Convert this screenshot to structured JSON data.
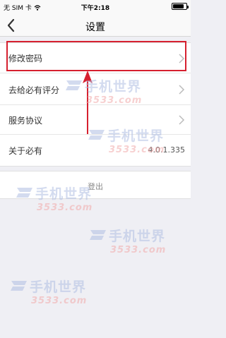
{
  "status_bar": {
    "carrier": "无 SIM 卡",
    "time": "下午2:18",
    "battery_level": 0.85
  },
  "nav": {
    "title": "设置",
    "back_icon": "chevron-left-icon"
  },
  "settings": {
    "items": [
      {
        "label": "修改密码",
        "value": ""
      },
      {
        "label": "去给必有评分",
        "value": ""
      },
      {
        "label": "服务协议",
        "value": ""
      },
      {
        "label": "关于必有",
        "value": "4.0.1.335"
      }
    ]
  },
  "logout": {
    "label": "登出"
  },
  "watermark": {
    "name": "手机世界",
    "site": "3533.com"
  },
  "colors": {
    "highlight": "#d6202f",
    "arrow": "#d6202f",
    "background": "#efeff4"
  }
}
